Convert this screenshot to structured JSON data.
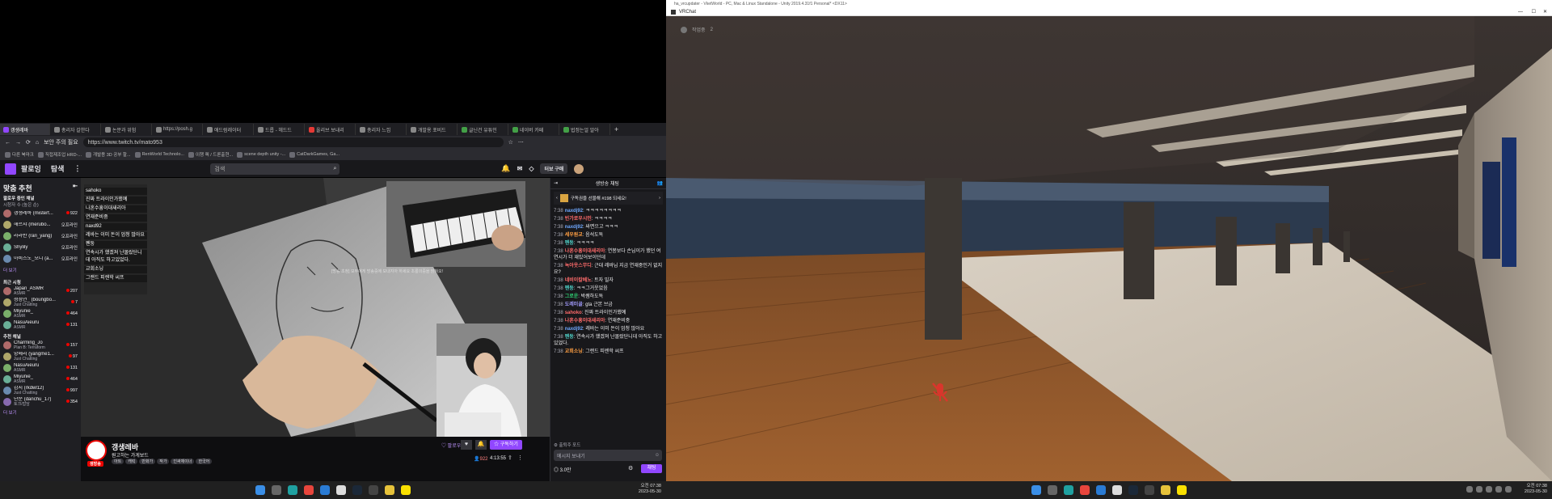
{
  "left_browser": {
    "tabs": [
      {
        "label": "갱생레바",
        "color": "#9147ff",
        "active": true
      },
      {
        "label": "총리자 갈한다",
        "color": "#888"
      },
      {
        "label": "논문과 위험",
        "color": "#888"
      },
      {
        "label": "https://posh.g",
        "color": "#888"
      },
      {
        "label": "애드럼레이터",
        "color": "#888"
      },
      {
        "label": "드롭 - 헤드드",
        "color": "#888"
      },
      {
        "label": "올리브 보내리",
        "color": "#e53935"
      },
      {
        "label": "총리자 느낌",
        "color": "#888"
      },
      {
        "label": "개발용 포비드",
        "color": "#888"
      },
      {
        "label": "글닌건 유튜인",
        "color": "#43a047"
      },
      {
        "label": "네이버 카페",
        "color": "#43a047"
      },
      {
        "label": "법정는얼 알아",
        "color": "#43a047"
      }
    ],
    "security_label": "보안 주의 필요",
    "url": "https://www.twitch.tv/mato953",
    "bookmarks": [
      "다른 북마크",
      "직접제조업 HRD-...",
      "개발용 3D 공부 할...",
      "RenWorld Technolo...",
      "이챙 렉 / 드론출현...",
      "scene depth unity -...",
      "CatDarkGames, Ga..."
    ]
  },
  "twitch": {
    "nav": {
      "following": "팔로잉",
      "browse": "탐색",
      "search_placeholder": "검색",
      "turbo": "터보 구매"
    },
    "sidebar": {
      "title": "맞춤 추천",
      "followed_header": "팔로우 중인 채널",
      "followed_sub": "시청자 수 (높은 순)",
      "followed": [
        {
          "name": "갱생레바 (misterf...",
          "cat": "",
          "viewers": "922",
          "live": true
        },
        {
          "name": "해르샤 (merubo...",
          "cat": "",
          "viewers": "오프라인",
          "live": false
        },
        {
          "name": "라라반 (rari_yang)",
          "cat": "",
          "viewers": "오프라인",
          "live": false
        },
        {
          "name": "Shylily",
          "cat": "",
          "viewers": "오프라인",
          "live": false
        },
        {
          "name": "아비즈노_모니 (a...",
          "cat": "",
          "viewers": "오프라인",
          "live": false
        }
      ],
      "show_more": "더 보기",
      "recent_header": "최근 시청",
      "recent": [
        {
          "name": "Japan_ASMR",
          "cat": "ASMR",
          "viewers": "207"
        },
        {
          "name": "청정연_ (boungbo...",
          "cat": "Just Chatting",
          "viewers": "7"
        },
        {
          "name": "Miyunie_",
          "cat": "ASMR",
          "viewers": "464"
        },
        {
          "name": "NasuAieuru",
          "cat": "ASMR",
          "viewers": "131"
        }
      ],
      "recommended_header": "추천 채널",
      "recommended": [
        {
          "name": "Charming_Jo",
          "cat": "Plan B: Terraform",
          "viewers": "157"
        },
        {
          "name": "양메리 (yangme1...",
          "cat": "Just Chatting",
          "viewers": "97"
        },
        {
          "name": "NasuAieuru",
          "cat": "ASMR",
          "viewers": "131"
        },
        {
          "name": "Miyunie_",
          "cat": "ASMR",
          "viewers": "464"
        },
        {
          "name": "감지 (rkdwl12)",
          "cat": "Just Chatting",
          "viewers": "997"
        },
        {
          "name": "단순 (danchu_17)",
          "cat": "토크/잡담",
          "viewers": "354"
        }
      ],
      "show_more2": "더 보기"
    },
    "overlay_chat": [
      "sahoko",
      "진짜 트라이인가했예",
      "나혼수흥이대새리아",
      "연재준비중",
      "naxd92",
      "레바는 이미 돈이 엄청 많아요",
      "펜둥",
      "연속시가 했겠져 난몰랐단니데 아직도 하고있었다.",
      "교회소닝",
      "그랜드 피렌학 씨프"
    ],
    "video_caption": "[방송 초청] 모두에게 방송중에 보내지아 하세요 초롱의중을 밝혀오!",
    "streamer": {
      "name": "갱생레바",
      "title": "원고하는 가게보드",
      "live_badge": "생방송",
      "tags": [
        "아트",
        "캐릭",
        "만화가",
        "작가",
        "인싸체이너",
        "한국어"
      ],
      "follow": "팔로우",
      "subscribe": "구독하기",
      "viewers": "922",
      "uptime": "4:13:55"
    },
    "chat": {
      "header": "생방송 채팅",
      "pinned": "구독권을 선물해 #198 되세요!",
      "messages": [
        {
          "t": "7:38",
          "u": "naxdj92",
          "c": "#6fa8ff",
          "m": "ㅋㅋㅋㅋㅋㅋㅋㅋ"
        },
        {
          "t": "7:38",
          "u": "빈가로우시인",
          "c": "#ff6b6b",
          "m": "ㅋㅋㅋㅋ"
        },
        {
          "t": "7:38",
          "u": "naxdj92",
          "c": "#6fa8ff",
          "m": "싸면으고 ㅋㅋㅋ"
        },
        {
          "t": "7:38",
          "u": "세우원교",
          "c": "#ff9f43",
          "m": "음석도독"
        },
        {
          "t": "7:38",
          "u": "펜둥",
          "c": "#4ecdc4",
          "m": "ㅋㅋㅋㅋ"
        },
        {
          "t": "7:38",
          "u": "나혼수흥이대새리아",
          "c": "#ff6b6b",
          "m": "연봉보다 손님이가 했던 여연시가 더 재밌어보이던데"
        },
        {
          "t": "7:38",
          "u": "녹아웃스무디",
          "c": "#ff6b6b",
          "m": "근대 레바님 지금 연재중인거 없지요?"
        },
        {
          "t": "7:38",
          "u": "네비이칼베노",
          "c": "#ff6b6b",
          "m": "트자 밀자"
        },
        {
          "t": "7:38",
          "u": "펜둥",
          "c": "#4ecdc4",
          "m": "ㅋㅋ그거웃었음"
        },
        {
          "t": "7:38",
          "u": "그로운",
          "c": "#2ecc71",
          "m": "박쌤하도독"
        },
        {
          "t": "7:38",
          "u": "도레미골",
          "c": "#a29bfe",
          "m": "gta 근본 브금"
        },
        {
          "t": "7:38",
          "u": "sahoko",
          "c": "#ff6b6b",
          "m": "진짜 트라이인가했예"
        },
        {
          "t": "7:38",
          "u": "나혼수흥이대새리아",
          "c": "#ff6b6b",
          "m": "연재준비중"
        },
        {
          "t": "7:38",
          "u": "naxdj92",
          "c": "#6fa8ff",
          "m": "레바는 이미 돈이 엄청 많아요"
        },
        {
          "t": "7:38",
          "u": "펜둥",
          "c": "#4ecdc4",
          "m": "연속시가 했겠져 난몰랐단니데 아직도 하고있었다."
        },
        {
          "t": "7:38",
          "u": "교회소닝",
          "c": "#ff9f43",
          "m": "그랜드 피렌학 씨프"
        }
      ],
      "send_placeholder": "메시지 보내기",
      "points": "3.0만",
      "send": "채팅",
      "stalled": "출퇴주 포드"
    }
  },
  "left_taskbar": {
    "time": "오전 07:38",
    "date": "2023-05-30"
  },
  "vrchat": {
    "window_title": "VRChat",
    "small_title": "ha_vrcupdater - VketWorld - PC, Mac & Linux Standalone - Unity 2019.4.31f1 Personal* <DX11>",
    "hud_text": "작업중",
    "hud_count": "2"
  },
  "right_taskbar": {
    "time": "오전 07:38",
    "date": "2023-05-30"
  },
  "colors": {
    "twitch_purple": "#9147ff",
    "live_red": "#eb0400"
  }
}
